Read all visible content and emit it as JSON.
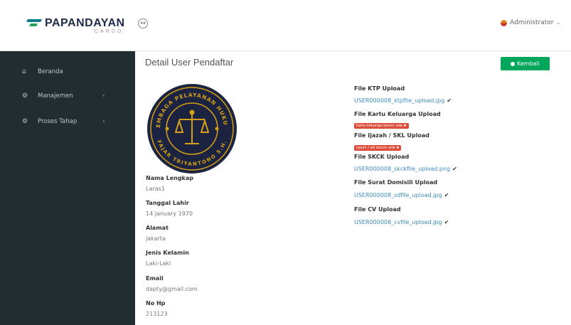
{
  "brand": {
    "name": "PAPANDAYAN",
    "sub": "CARGO"
  },
  "header": {
    "user_name": "Administrator",
    "toggle_glyph": "↔"
  },
  "sidebar": {
    "items": [
      {
        "label": "Beranda",
        "icon": "home-icon",
        "glyph": "⌂"
      },
      {
        "label": "Manajemen",
        "icon": "cogs-icon",
        "glyph": "⚙",
        "caret": "‹"
      },
      {
        "label": "Proses Tahap",
        "icon": "gear-icon",
        "glyph": "⚙",
        "caret": "‹"
      }
    ]
  },
  "main": {
    "title": "Detail User Pendaftar",
    "back_button": "Kembali",
    "seal_text_top": "LEMBAGA PELAYANAN HUKUM",
    "seal_text_bottom": "FAJAR TRIYANTONO S.H.",
    "fields": [
      {
        "label": "Nama Lengkap",
        "value": "Laras1"
      },
      {
        "label": "Tanggal Lahir",
        "value": "14 January 1970"
      },
      {
        "label": "Alamat",
        "value": "jakarta"
      },
      {
        "label": "Jenis Kelamin",
        "value": "Laki-Laki"
      },
      {
        "label": "Email",
        "value": "dapty@gmail.com"
      },
      {
        "label": "No Hp",
        "value": "213123"
      }
    ],
    "files": {
      "ktp": {
        "label": "File KTP Upload",
        "link": "USER000008_ktpfile_upload.jpg"
      },
      "kk": {
        "label": "File Kartu Keluarga Upload",
        "badge": "Kartu keluarga belum ada ✖"
      },
      "ijazah": {
        "label": "File Ijazah / SKL Upload",
        "badge": "Ijazah / skl belum ada ✖"
      },
      "skck": {
        "label": "File SKCK Upload",
        "link": "USER000008_skckfile_upload.png"
      },
      "domisili": {
        "label": "File Surat Domisili Upload",
        "link": "USER000008_sdfile_upload.jpg"
      },
      "cv": {
        "label": "File CV Upload",
        "link": "USER000008_cvfile_upload.jpg"
      }
    },
    "check_glyph": "✔"
  },
  "colors": {
    "sidebar": "#222d32",
    "accent": "#00a65a",
    "link": "#3c8dbc",
    "danger": "#dd4b39",
    "seal_gold": "#d4a017",
    "seal_dark": "#1c2340"
  }
}
